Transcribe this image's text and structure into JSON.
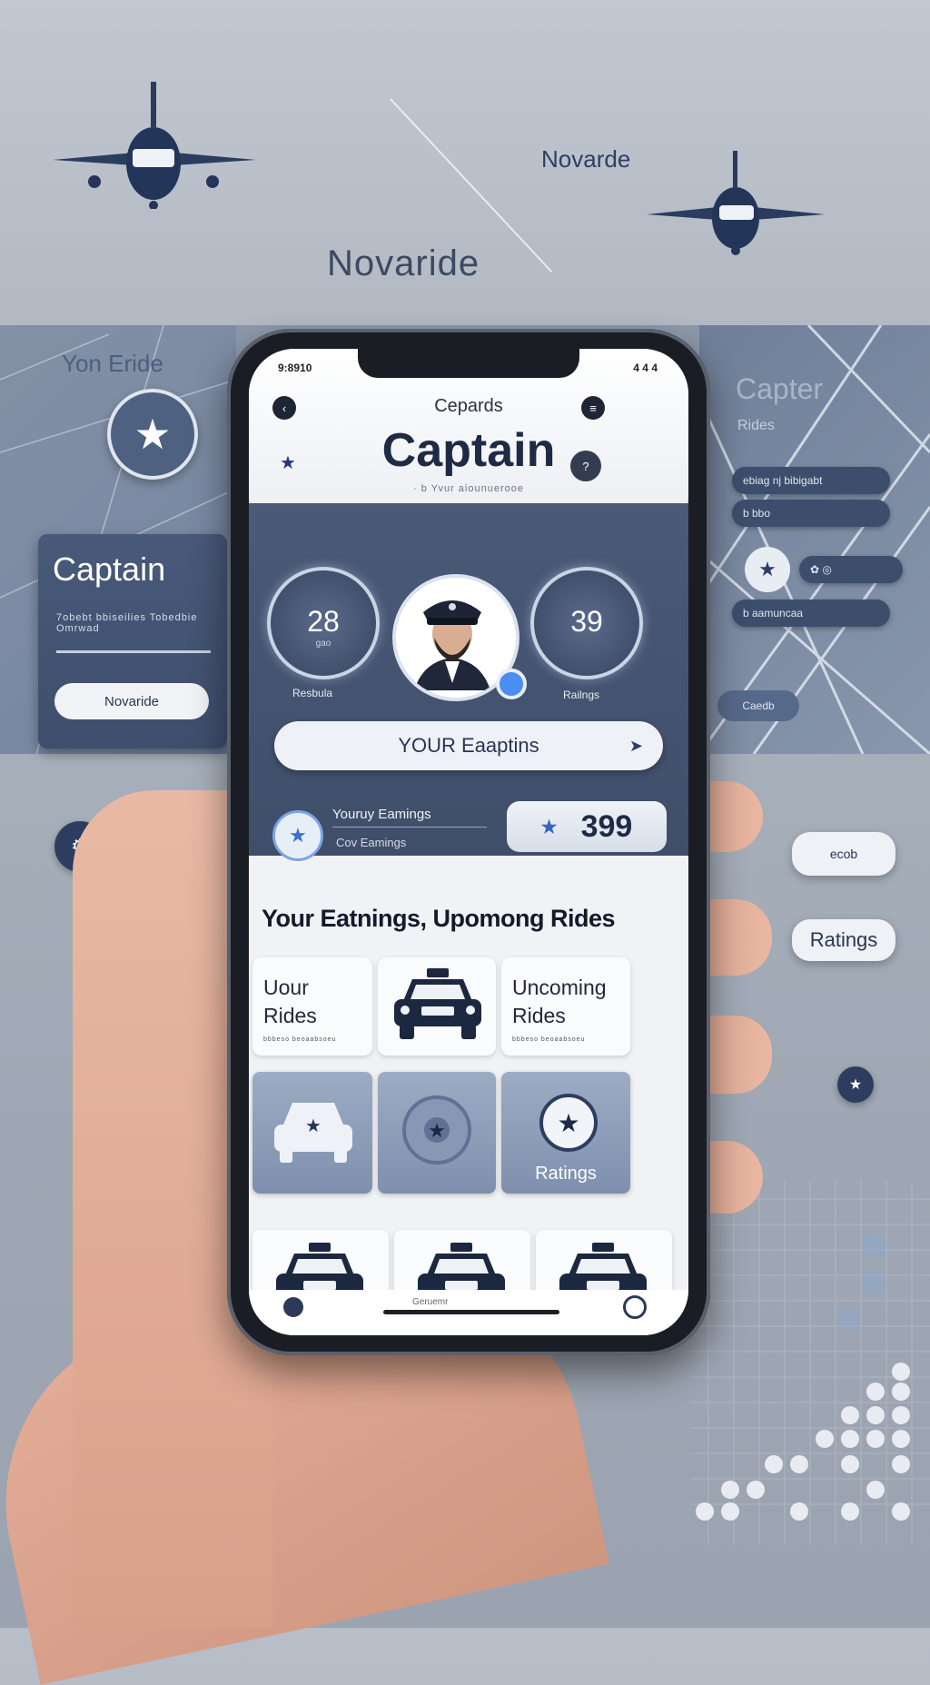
{
  "background": {
    "brand_center": "Novaride",
    "brand_right": "Novarde",
    "left_panel": {
      "title": "Yon Eride",
      "captain_card_title": "Captain",
      "captain_card_subtitle": "7obebt bbiseilies  Tobedbie   Omrwad",
      "captain_card_button": "Novaride"
    },
    "right_panel": {
      "title": "Capter",
      "subtitle": "Rides",
      "pill_1": "ebiag nj bibigabt",
      "pill_2": "b bbo",
      "pill_3": "b  aamuncaa",
      "pill_small": "Caedb"
    },
    "float_pill_top": "ecob",
    "float_pill_ratings": "Ratings"
  },
  "phone": {
    "status_left": "9:8910",
    "status_right": "4 4 4",
    "header": {
      "app_name": "Cepards",
      "title": "Captain",
      "tagline": "·  b  Yvur aiounuerooe"
    },
    "dashboard": {
      "gauge_left": {
        "value": "28",
        "caption": "gao",
        "label": "Resbula"
      },
      "gauge_right": {
        "value": "39",
        "caption": "",
        "label": "Railngs"
      },
      "earnings_button": "YOUR Eaaptins",
      "earnings_line1": "Youruy  Eamings",
      "earnings_line2": "Cov  Eamings",
      "earnings_value": "399"
    },
    "section_title": "Your Eatnings, Upomong Rides",
    "cards": [
      {
        "title": "Uour\nRides",
        "subtitle": "bbbeso beoaabsoeu"
      },
      {
        "title": "Uncoming\nRides",
        "subtitle": "bbbeso beoaabsoeu"
      }
    ],
    "tiles": [
      {
        "label": ""
      },
      {
        "label": ""
      },
      {
        "label": "Ratings"
      }
    ],
    "bottom_nav": {
      "center": "Geruemr"
    }
  },
  "colors": {
    "accent": "#3a66c2",
    "dashboard_bg": "#45546f",
    "header_bg": "#ffffff",
    "dark_text": "#1f2a44"
  }
}
